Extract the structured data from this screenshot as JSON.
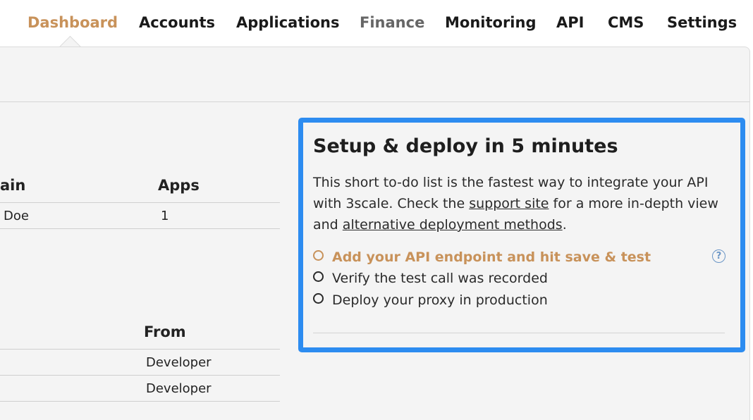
{
  "nav": {
    "items": [
      {
        "label": "Dashboard"
      },
      {
        "label": "Accounts"
      },
      {
        "label": "Applications"
      },
      {
        "label": "Finance"
      },
      {
        "label": "Monitoring"
      },
      {
        "label": "API"
      },
      {
        "label": "CMS"
      },
      {
        "label": "Settings"
      }
    ],
    "active": "Dashboard"
  },
  "accounts_table": {
    "columns": [
      "ain",
      "Apps"
    ],
    "rows": [
      {
        "name": "Doe",
        "apps": "1"
      }
    ]
  },
  "messages_table": {
    "columns": [
      "From"
    ],
    "rows": [
      {
        "from": "Developer"
      },
      {
        "from": "Developer"
      }
    ]
  },
  "setup": {
    "title": "Setup & deploy in 5 minutes",
    "desc_part1": "This short to-do list is the fastest way to integrate your API with 3scale. Check the ",
    "support_link": "support site",
    "desc_part2": " for a more in-depth view and ",
    "alt_link": "alternative deployment methods",
    "desc_part3": ".",
    "tasks": [
      {
        "label": "Add your API endpoint and hit save & test",
        "status": "current"
      },
      {
        "label": "Verify the test call was recorded",
        "status": "pending"
      },
      {
        "label": "Deploy your proxy in production",
        "status": "pending"
      }
    ],
    "help_symbol": "?"
  },
  "colors": {
    "accent": "#c8925a",
    "highlight_border": "#2d8cf0",
    "help_icon": "#6b96c6",
    "panel_bg": "#f4f4f4"
  }
}
